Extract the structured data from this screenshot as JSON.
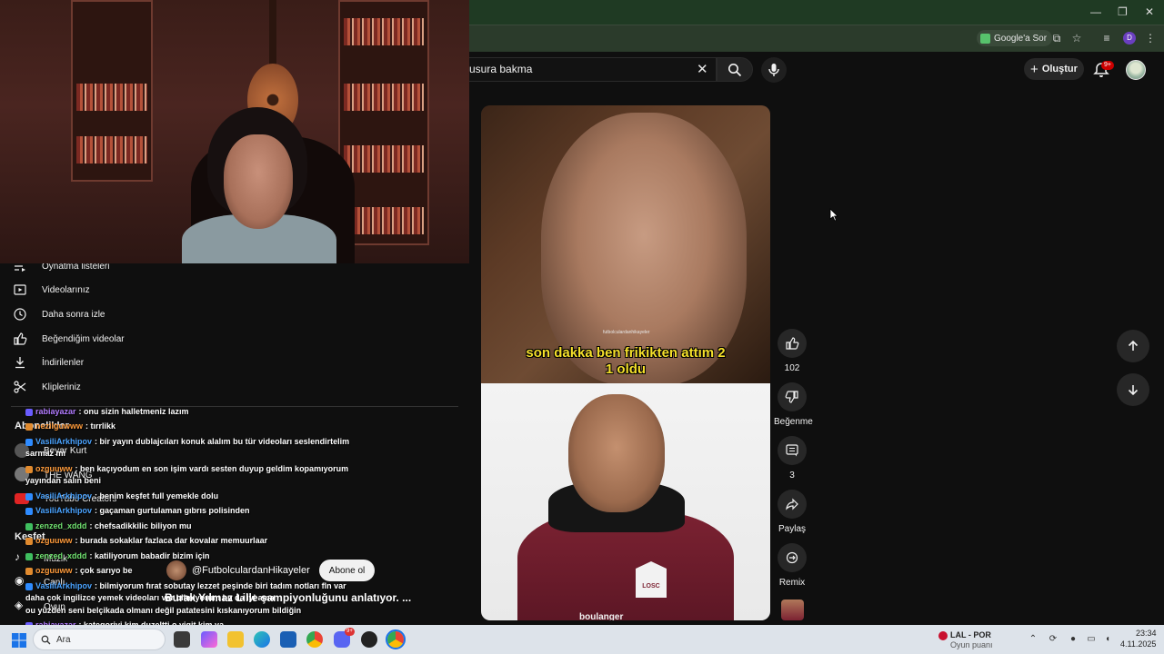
{
  "browser": {
    "window_controls": [
      "—",
      "❐",
      "✕"
    ],
    "google_ask_label": "Google'a Sor"
  },
  "header": {
    "search_value": "usura bakma",
    "create_label": "Oluştur",
    "notification_count": "9+"
  },
  "video": {
    "subtitle_line1": "son dakka ben frikikten attım 2",
    "subtitle_line2": "1 oldu",
    "watermark": "futbolculardanhikayeler",
    "jersey_text": "LOSC",
    "sponsor_text": "boulanger"
  },
  "actions": {
    "like_count": "102",
    "dislike_label": "Beğenme",
    "comment_count": "3",
    "share_label": "Paylaş",
    "remix_label": "Remix"
  },
  "sidebar": {
    "items": [
      {
        "label": "Oynatma listeleri",
        "icon": "playlist-icon"
      },
      {
        "label": "Videolarınız",
        "icon": "video-icon"
      },
      {
        "label": "Daha sonra izle",
        "icon": "clock-icon"
      },
      {
        "label": "Beğendiğim videolar",
        "icon": "thumbs-up-icon"
      },
      {
        "label": "İndirilenler",
        "icon": "download-icon"
      },
      {
        "label": "Klipleriniz",
        "icon": "scissors-icon"
      }
    ],
    "subs_header": "Abonelikler",
    "subs": [
      "Beyar Kurt",
      "THE WANG",
      "YouTube Creators"
    ],
    "explore_header": "Keşfet",
    "explore": [
      "Müzik",
      "Canlı",
      "Oyun"
    ]
  },
  "chat": [
    {
      "user": "rabiayazar",
      "color": "purple",
      "text": ": onu sizin halletmeniz lazım"
    },
    {
      "user": "nezilguwww",
      "color": "orange",
      "text": ": tırrlikk"
    },
    {
      "user": "VasiliArkhipov",
      "color": "blue",
      "text": ": bir yayın dublajcıları konuk alalım bu tür videoları seslendirtelim"
    },
    {
      "user": "",
      "color": "white",
      "text": "sarmaz mı"
    },
    {
      "user": "ozguuww",
      "color": "orange",
      "text": ": ben kaçıyodum en son işim vardı sesten duyup geldim kopamıyorum"
    },
    {
      "user": "",
      "color": "white",
      "text": "yayından salın beni"
    },
    {
      "user": "VasiliArkhipov",
      "color": "blue",
      "text": ": benim keşfet full yemekle dolu"
    },
    {
      "user": "VasiliArkhipov",
      "color": "blue",
      "text": ": gaçaman gurtulaman gıbrıs polisinden"
    },
    {
      "user": "zenzed_xddd",
      "color": "green",
      "text": ": chefsadikkilic biliyon mu"
    },
    {
      "user": "ozguuww",
      "color": "orange",
      "text": ": burada sokaklar fazlaca dar kovalar memuurlaar"
    },
    {
      "user": "zenzed_xddd",
      "color": "green",
      "text": ": katiliyorum babadir bizim için"
    },
    {
      "user": "ozguuww",
      "color": "orange",
      "text": ": çok sarıyo be"
    },
    {
      "user": "VasiliArkhipov",
      "color": "blue",
      "text": ": bilmiyorum fırat sobutay lezzet peşinde biri tadım notları fln var"
    },
    {
      "user": "",
      "color": "white",
      "text": "daha çok ingilizce yemek videoları var bilmiyorum bu da iyi ama"
    },
    {
      "user": "",
      "color": "white",
      "text": "ou yüzden seni belçikada olmanı değil patatesini kıskanıyorum bildiğin"
    },
    {
      "user": "rabiayazar",
      "color": "purple",
      "text": ": kategoriyi kim duzeltti o yigit kim ya"
    }
  ],
  "channel": {
    "name": "@FutbolculardanHikayeler",
    "subscribe_label": "Abone ol",
    "description": "Burak Yılmaz Lille şampiyonluğunu anlatıyor. ..."
  },
  "taskbar": {
    "search_placeholder": "Ara",
    "discord_badge": "9+",
    "game_title": "LAL - POR",
    "game_subtitle": "Oyun puanı",
    "time": "23:34",
    "date": "4.11.2025"
  },
  "colors": {
    "bg": "#0f0f0f",
    "accent_red": "#cc0000",
    "subtitle_yellow": "#f5e02b"
  }
}
